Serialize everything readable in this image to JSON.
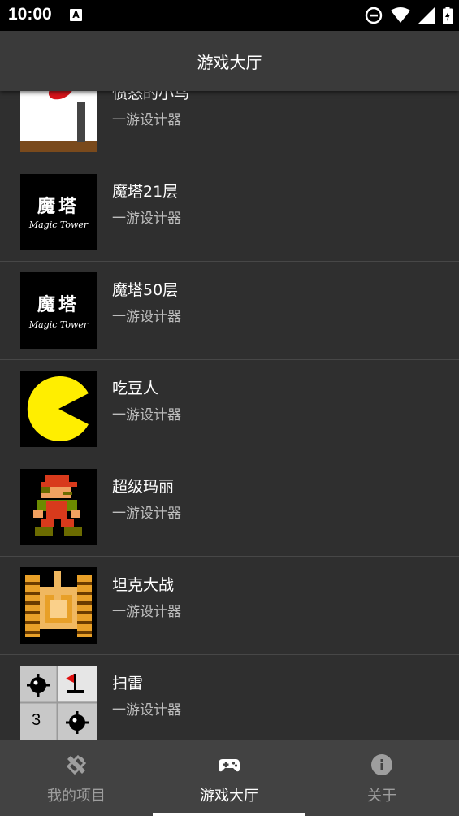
{
  "status": {
    "time": "10:00",
    "notification_badge": "A"
  },
  "appbar": {
    "title": "游戏大厅"
  },
  "games": [
    {
      "title": "愤怒的小鸟",
      "author": "一游设计器",
      "icon": "angry-bird-icon"
    },
    {
      "title": "魔塔21层",
      "author": "一游设计器",
      "icon": "magic-tower-icon",
      "logo_text": "魔塔",
      "logo_sub": "Magic Tower"
    },
    {
      "title": "魔塔50层",
      "author": "一游设计器",
      "icon": "magic-tower-icon",
      "logo_text": "魔塔",
      "logo_sub": "Magic Tower"
    },
    {
      "title": "吃豆人",
      "author": "一游设计器",
      "icon": "pacman-icon"
    },
    {
      "title": "超级玛丽",
      "author": "一游设计器",
      "icon": "mario-icon"
    },
    {
      "title": "坦克大战",
      "author": "一游设计器",
      "icon": "tank-icon"
    },
    {
      "title": "扫雷",
      "author": "一游设计器",
      "icon": "minesweeper-icon",
      "cell_number": "3"
    }
  ],
  "bottom_nav": {
    "items": [
      {
        "label": "我的项目",
        "icon": "design-tools-icon",
        "active": false
      },
      {
        "label": "游戏大厅",
        "icon": "gamepad-icon",
        "active": true
      },
      {
        "label": "关于",
        "icon": "info-icon",
        "active": false
      }
    ]
  },
  "colors": {
    "active": "#ffffff",
    "inactive": "#9e9e9e",
    "background": "#2f2f2f",
    "appbar": "#3a3a3a",
    "bottom_nav": "#424242"
  }
}
